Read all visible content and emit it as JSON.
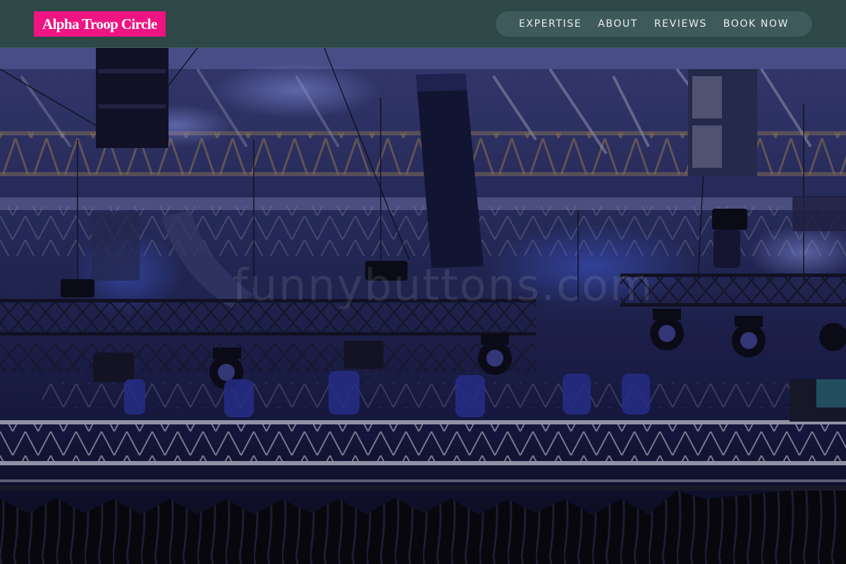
{
  "header": {
    "brand": "Alpha Troop Circle",
    "nav": [
      {
        "label": "EXPERTISE"
      },
      {
        "label": "ABOUT"
      },
      {
        "label": "REVIEWS"
      },
      {
        "label": "BOOK NOW"
      }
    ]
  },
  "hero": {
    "image_subject": "concert stage lighting rig with trusses, moving head lights and line-array speakers",
    "watermark": "funnybuttons.com"
  },
  "colors": {
    "header_bg": "#2e4747",
    "nav_pill": "#3f5a5a",
    "brand_bg": "#ee1483",
    "nav_text": "#e9f0ef"
  },
  "icons": [
    "moving-head-light-icon",
    "speaker-array-icon",
    "truss-icon"
  ]
}
